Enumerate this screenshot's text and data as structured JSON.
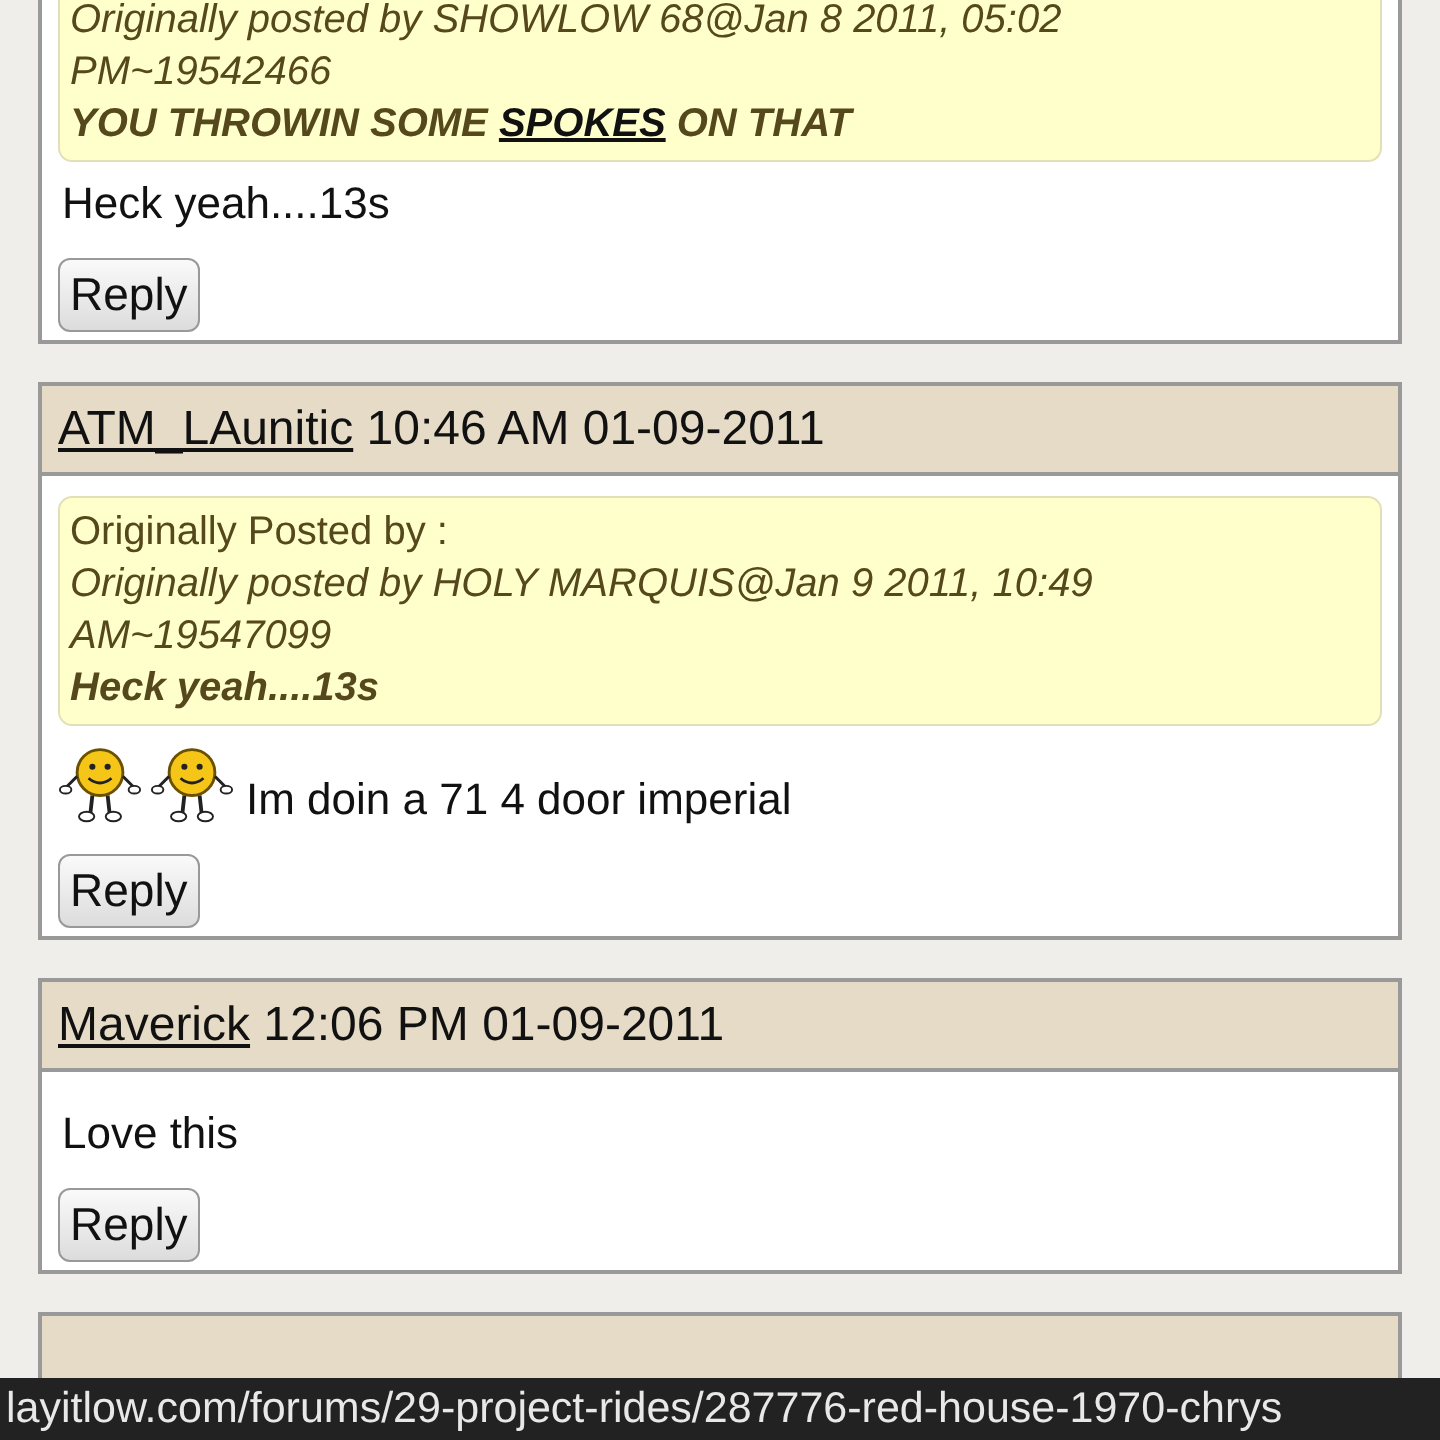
{
  "posts": [
    {
      "quote": {
        "source": "Originally posted by SHOWLOW 68@Jan 8 2011, 05:02 PM~19542466",
        "content": [
          {
            "kind": "text",
            "text": "YOU THROWIN SOME "
          },
          {
            "kind": "link",
            "text": "SPOKES"
          },
          {
            "kind": "text",
            "text": " ON THAT"
          }
        ]
      },
      "body": [
        {
          "kind": "text",
          "text": "Heck yeah....13s"
        }
      ],
      "reply": "Reply"
    },
    {
      "author": "ATM_LAunitic",
      "time": "10:46 AM 01-09-2011",
      "quote": {
        "heading": "Originally Posted by :",
        "source": "Originally posted by HOLY MARQUIS@Jan 9 2011, 10:49 AM~19547099",
        "content": [
          {
            "kind": "text",
            "text": "Heck yeah....13s"
          }
        ]
      },
      "body": [
        {
          "kind": "smiley"
        },
        {
          "kind": "smiley"
        },
        {
          "kind": "text",
          "text": "Im doin a 71 4 door imperial"
        }
      ],
      "reply": "Reply"
    },
    {
      "author": "Maverick",
      "time": "12:06 PM 01-09-2011",
      "body": [
        {
          "kind": "text",
          "text": "Love this"
        }
      ],
      "reply": "Reply"
    }
  ],
  "status_url": "layitlow.com/forums/29-project-rides/287776-red-house-1970-chrys"
}
